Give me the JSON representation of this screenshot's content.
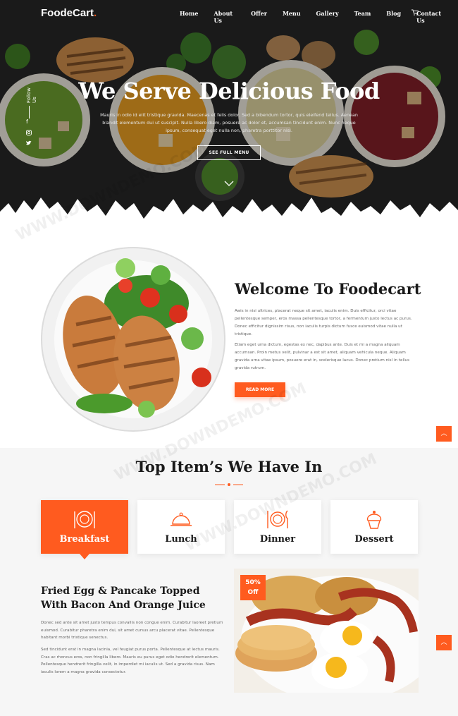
{
  "nav": {
    "logo_main": "FoodeCart",
    "logo_dot": ".",
    "items": [
      "Home",
      "About Us",
      "Offer",
      "Menu",
      "Gallery",
      "Team",
      "Blog",
      "Contact Us"
    ]
  },
  "hero": {
    "follow_label": "Follow Us",
    "title": "We Serve Delicious Food",
    "text": "Mauris in odio id elit tristique gravida. Maecenas et felis dolor. Sed a bibendum tortor, quis eleifend tellus. Aenean blandit elementum dui ut suscipit. Nulla libero diam, posuere ac dolor et, accumsan tincidunt enim. Nunc neque ipsum, consequat eget nulla non, pharetra porttitor nisi.",
    "button": "SEE FULL MENU"
  },
  "welcome": {
    "title": "Welcome To Foodecart",
    "p1": "Awis in nisi ultrices, placerat neque sit amet, iaculis enim. Duis efficitur, orci vitae pellentesque semper, eros massa pellentesque tortor, a fermentum justo lectus ac purus. Donec efficitur dignissim risus, non iaculis turpis dictum fusce euismod vitae nulla ut tristique.",
    "p2": "Etiam eget urna dictum, egestas ex nec, dapibus ante. Duis et mi a magna aliquam accumsan. Proin metus velit, pulvinar a est sit amet, aliquam vehicula neque. Aliquam gravida urna vitae ipsum, posuere erat in, scelerisque lacus. Donec pretium nisl in tellus gravida rutrum.",
    "button": "READ MORE"
  },
  "top_items": {
    "title": "Top Item’s We Have In",
    "tabs": [
      {
        "label": "Breakfast",
        "icon": "plate-cutlery-icon",
        "active": true
      },
      {
        "label": "Lunch",
        "icon": "cloche-icon",
        "active": false
      },
      {
        "label": "Dinner",
        "icon": "dinner-plate-icon",
        "active": false
      },
      {
        "label": "Dessert",
        "icon": "cupcake-icon",
        "active": false
      }
    ],
    "feature": {
      "title": "Fried Egg & Pancake Topped With Bacon And Orange Juice",
      "p1": "Donec sed ante sit amet justo tempus convallis non congue enim. Curabitur laoreet pretium euismod. Curabitur pharetra enim dui, sit amet cursus arcu placerat vitae. Pellentesque habitant morbi tristique senectus.",
      "p2": "Sed tincidunt erat in magna lacinia, vel feugiat purus porta. Pellentesque at lectus mauris. Cras ac rhoncus eros, non fringilla libero. Mauris eu purus eget odio hendrerit elementum. Pellentesque hendrerit fringilla velit, in imperdiet mi iaculis ut. Sed a gravida risus. Nam iaculis lorem a magna gravida consectetur.",
      "badge_pct": "50%",
      "badge_off": "Off"
    }
  },
  "watermark": "WWW.DOWNDEMO.COM",
  "colors": {
    "accent": "#ff5b1f",
    "dark": "#242424",
    "section_bg": "#f6f6f6"
  }
}
